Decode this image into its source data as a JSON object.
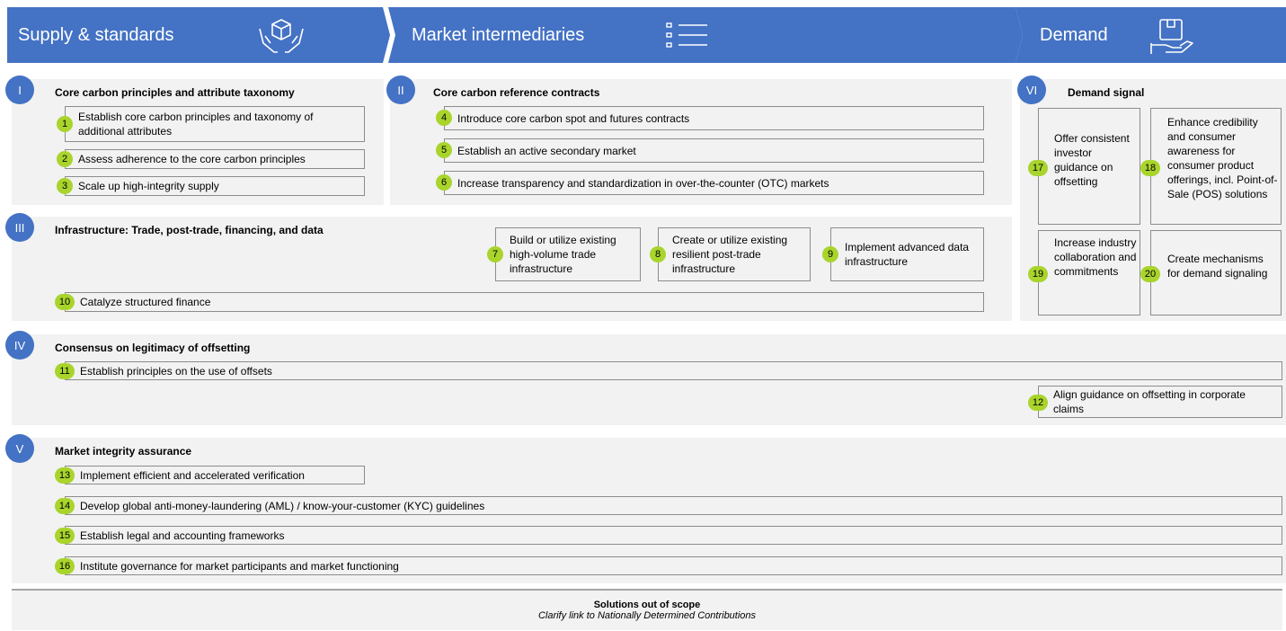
{
  "header": {
    "supply": "Supply & standards",
    "market": "Market intermediaries",
    "demand": "Demand",
    "colors": {
      "accent": "#4472c4",
      "badge": "#a9d42c",
      "panel": "#f2f2f2"
    },
    "icons": [
      "hand-box-icon",
      "list-icon",
      "hand-package-icon"
    ]
  },
  "panels": {
    "p1": {
      "roman": "I",
      "title": "Core carbon principles and attribute taxonomy"
    },
    "p2": {
      "roman": "II",
      "title": "Core carbon reference contracts"
    },
    "p3": {
      "roman": "III",
      "title": "Infrastructure: Trade, post-trade, financing, and data"
    },
    "p4": {
      "roman": "IV",
      "title": "Consensus on legitimacy of offsetting"
    },
    "p5": {
      "roman": "V",
      "title": "Market integrity assurance"
    },
    "p6": {
      "roman": "VI",
      "title": "Demand signal"
    }
  },
  "items": [
    {
      "n": "1",
      "text": "Establish core carbon principles and taxonomy of additional attributes"
    },
    {
      "n": "2",
      "text": "Assess adherence to the core carbon principles"
    },
    {
      "n": "3",
      "text": "Scale up high-integrity supply"
    },
    {
      "n": "4",
      "text": "Introduce core carbon spot and futures contracts"
    },
    {
      "n": "5",
      "text": "Establish an active secondary market"
    },
    {
      "n": "6",
      "text": "Increase transparency and standardization in over-the-counter (OTC) markets"
    },
    {
      "n": "7",
      "text": "Build or utilize existing high-volume trade infrastructure"
    },
    {
      "n": "8",
      "text": "Create or utilize existing resilient post-trade infrastructure"
    },
    {
      "n": "9",
      "text": "Implement advanced data infrastructure"
    },
    {
      "n": "10",
      "text": "Catalyze structured finance"
    },
    {
      "n": "11",
      "text": "Establish principles on the use of offsets"
    },
    {
      "n": "12",
      "text": "Align guidance on offsetting in corporate claims"
    },
    {
      "n": "13",
      "text": "Implement efficient and accelerated verification"
    },
    {
      "n": "14",
      "text": "Develop global anti-money-laundering (AML) / know-your-customer (KYC) guidelines"
    },
    {
      "n": "15",
      "text": "Establish legal and accounting frameworks"
    },
    {
      "n": "16",
      "text": "Institute governance for market participants and market functioning"
    },
    {
      "n": "17",
      "text": "Offer consistent investor guidance on offsetting"
    },
    {
      "n": "18",
      "text": "Enhance credibility and consumer awareness for consumer product offerings, incl. Point-of-Sale (POS) solutions"
    },
    {
      "n": "19",
      "text": "Increase industry collaboration and commitments"
    },
    {
      "n": "20",
      "text": "Create mechanisms for demand signaling"
    }
  ],
  "footer": {
    "title": "Solutions out of scope",
    "subtitle": "Clarify link to Nationally Determined Contributions"
  }
}
